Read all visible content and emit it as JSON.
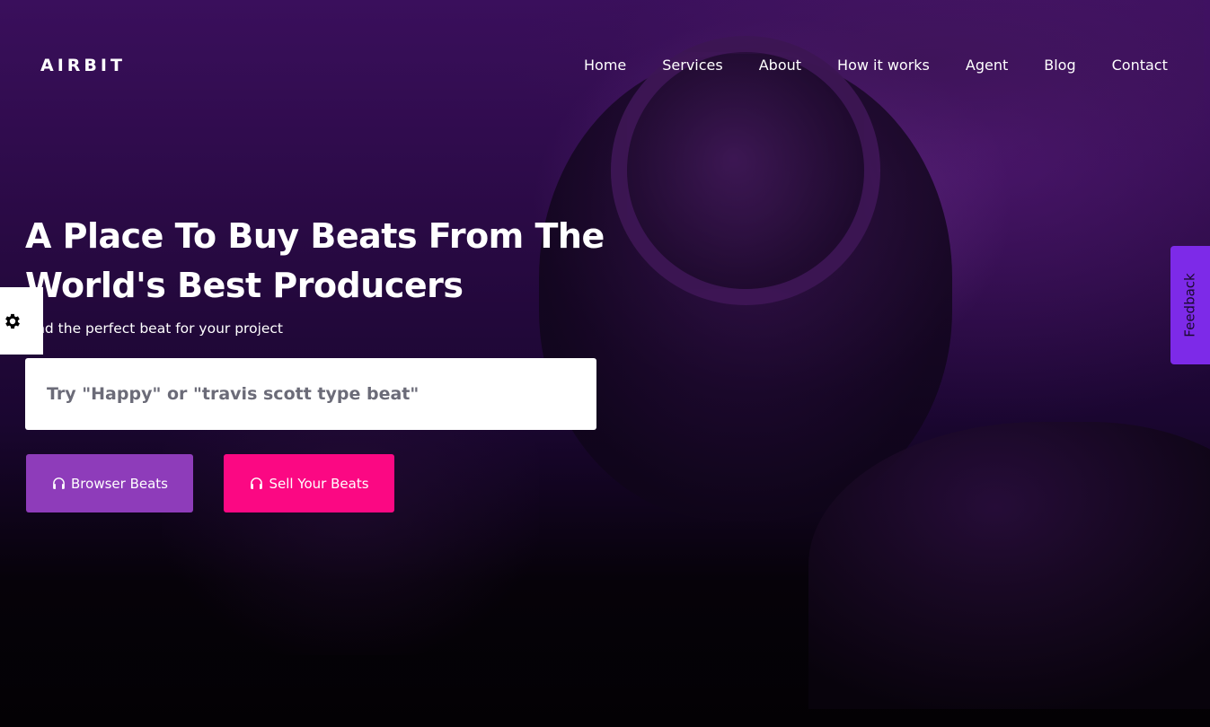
{
  "brand": {
    "name": "AIRBIT"
  },
  "nav": {
    "items": [
      "Home",
      "Services",
      "About",
      "How it works",
      "Agent",
      "Blog",
      "Contact"
    ]
  },
  "hero": {
    "headline": "A Place To Buy Beats From The World's Best Producers",
    "subline": "Find the perfect beat for your project"
  },
  "search": {
    "placeholder": "Try \"Happy\" or \"travis scott type beat\""
  },
  "buttons": {
    "browse_label": "Browser Beats",
    "sell_label": "Sell Your Beats"
  },
  "side_tabs": {
    "settings_icon": "gear-icon",
    "feedback_label": "Feedback"
  },
  "colors": {
    "browse_button": "#8e3cba",
    "sell_button": "#fb0883",
    "feedback_tab": "#7d2ae8",
    "hero_purple": "#3a0f5c"
  }
}
